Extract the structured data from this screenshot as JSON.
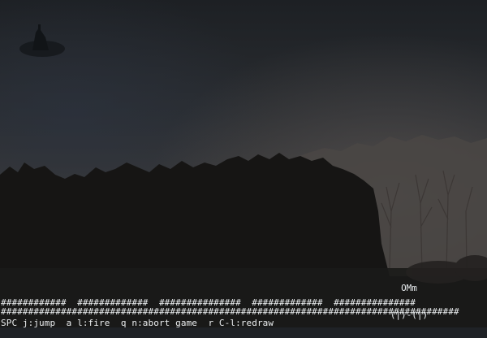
{
  "game": {
    "player": {
      "head": "OMm",
      "legs": "(|)-(|)"
    },
    "ground_top": "############  #############  ###############  #############  ###############",
    "ground_bottom": "####################################################################################",
    "status_line": "SPC j:jump  a l:fire  q n:abort game  r C-l:redraw"
  }
}
